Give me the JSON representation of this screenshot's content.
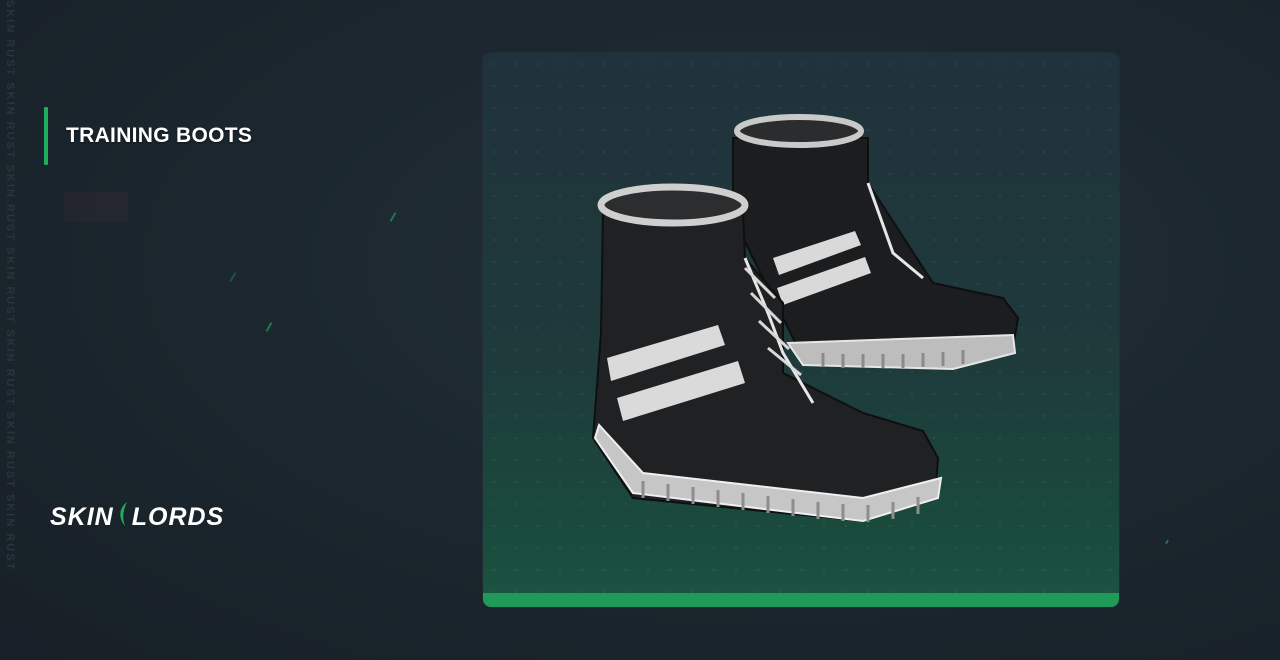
{
  "item": {
    "name": "TRAINING BOOTS"
  },
  "brand": {
    "logo_text_left": "SKIN",
    "logo_text_right": "LORDS"
  },
  "watermark": {
    "side_text": "SKIN RUST SKIN RUST SKIN RUST SKIN RUST SKIN RUST SKIN RUST SKIN RUST"
  },
  "colors": {
    "accent": "#1fae5b",
    "background": "#1c272f",
    "card_bottom_bar": "#1f9a58"
  },
  "icons": {
    "item_image": "boots-image",
    "logo_mark": "leaf-mark-icon"
  }
}
